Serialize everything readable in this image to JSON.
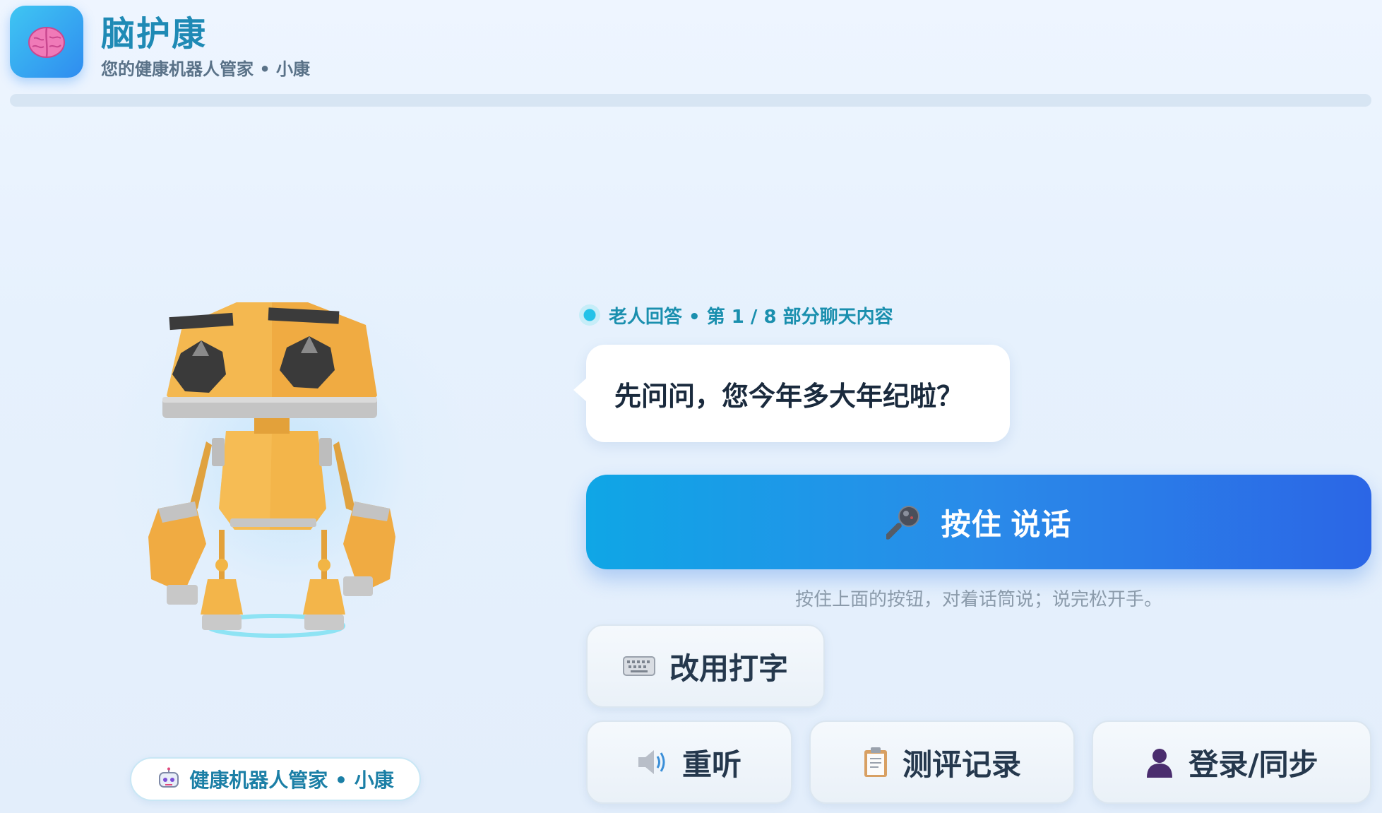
{
  "header": {
    "app_icon": "brain-icon",
    "title": "脑护康",
    "subtitle": "您的健康机器人管家 • 小康"
  },
  "robot": {
    "caption_icon": "robot-icon",
    "caption": "健康机器人管家 • 小康",
    "body_color": "#f0a93a"
  },
  "chat": {
    "status_label": "老人回答 • 第 1 / 8 部分聊天内容",
    "question": "先问问，您今年多大年纪啦？"
  },
  "actions": {
    "talk": {
      "icon": "microphone-icon",
      "label": "按住 说话"
    },
    "hint": "按住上面的按钮，对着话筒说；说完松开手。",
    "typing": {
      "icon": "keyboard-icon",
      "label": "改用打字"
    },
    "replay": {
      "icon": "speaker-icon",
      "label": "重听"
    },
    "records": {
      "icon": "clipboard-icon",
      "label": "测评记录"
    },
    "login": {
      "icon": "user-icon",
      "label": "登录/同步"
    }
  },
  "colors": {
    "accent": "#1f8ab5",
    "primary_button_start": "#0fa6e6",
    "primary_button_end": "#2b66e6",
    "status_dot": "#22c2e8"
  }
}
